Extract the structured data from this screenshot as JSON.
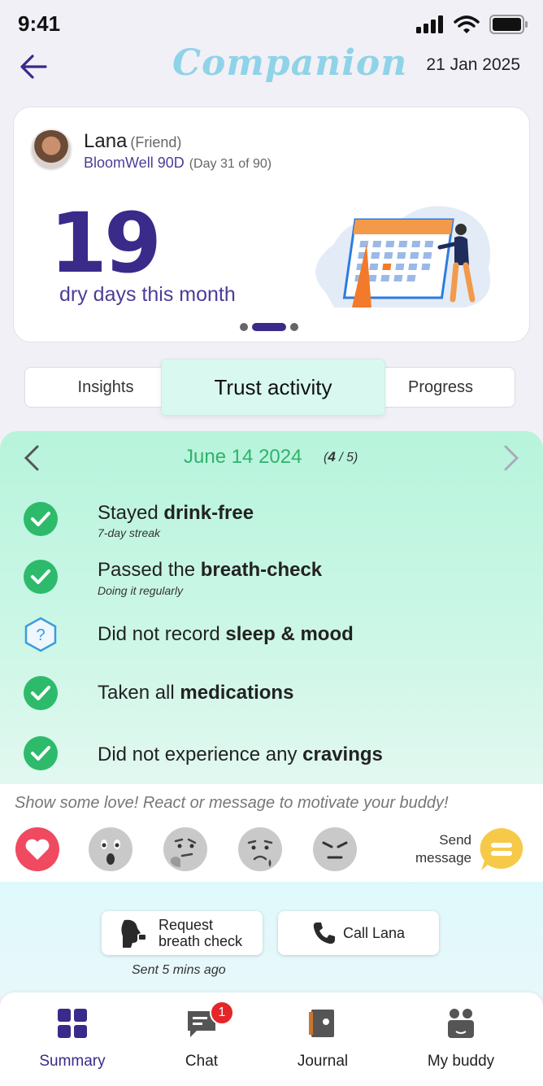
{
  "status_bar": {
    "time": "9:41"
  },
  "header": {
    "logo": "Companion",
    "date": "21 Jan 2025"
  },
  "hero": {
    "name": "Lana",
    "relation": "(Friend)",
    "program": "BloomWell 90D",
    "day": "(Day 31 of 90)",
    "big_number": "19",
    "caption": "dry days this month",
    "carousel_active_index": 1,
    "carousel_count": 3
  },
  "tabs": {
    "insights": "Insights",
    "trust": "Trust activity",
    "progress": "Progress"
  },
  "activity": {
    "date": "June 14 2024",
    "count_done": "4",
    "count_total": " / 5)",
    "items": [
      {
        "pre": "Stayed ",
        "bold": "drink-free",
        "sub": "7-day streak",
        "status": "done"
      },
      {
        "pre": "Passed the ",
        "bold": "breath-check",
        "sub": "Doing it regularly",
        "status": "done"
      },
      {
        "pre": "Did not record ",
        "bold": "sleep & mood",
        "sub": "",
        "status": "unknown"
      },
      {
        "pre": "Taken all ",
        "bold": "medications",
        "sub": "",
        "status": "done"
      },
      {
        "pre": "Did not experience any ",
        "bold": "cravings",
        "sub": "",
        "status": "done"
      }
    ]
  },
  "reactions": {
    "prompt": "Show some love! React or message to motivate your buddy!",
    "send_label_1": "Send",
    "send_label_2": "message"
  },
  "actions": {
    "request_line1": "Request",
    "request_line2": "breath check",
    "call": "Call Lana",
    "sent_note": "Sent 5 mins ago"
  },
  "bottom_nav": {
    "summary": "Summary",
    "chat": "Chat",
    "chat_badge": "1",
    "journal": "Journal",
    "buddy": "My buddy"
  },
  "colors": {
    "accent": "#3a2a8a",
    "success": "#2fb36a",
    "logo": "#8fd3e8",
    "badge": "#e4262b"
  }
}
